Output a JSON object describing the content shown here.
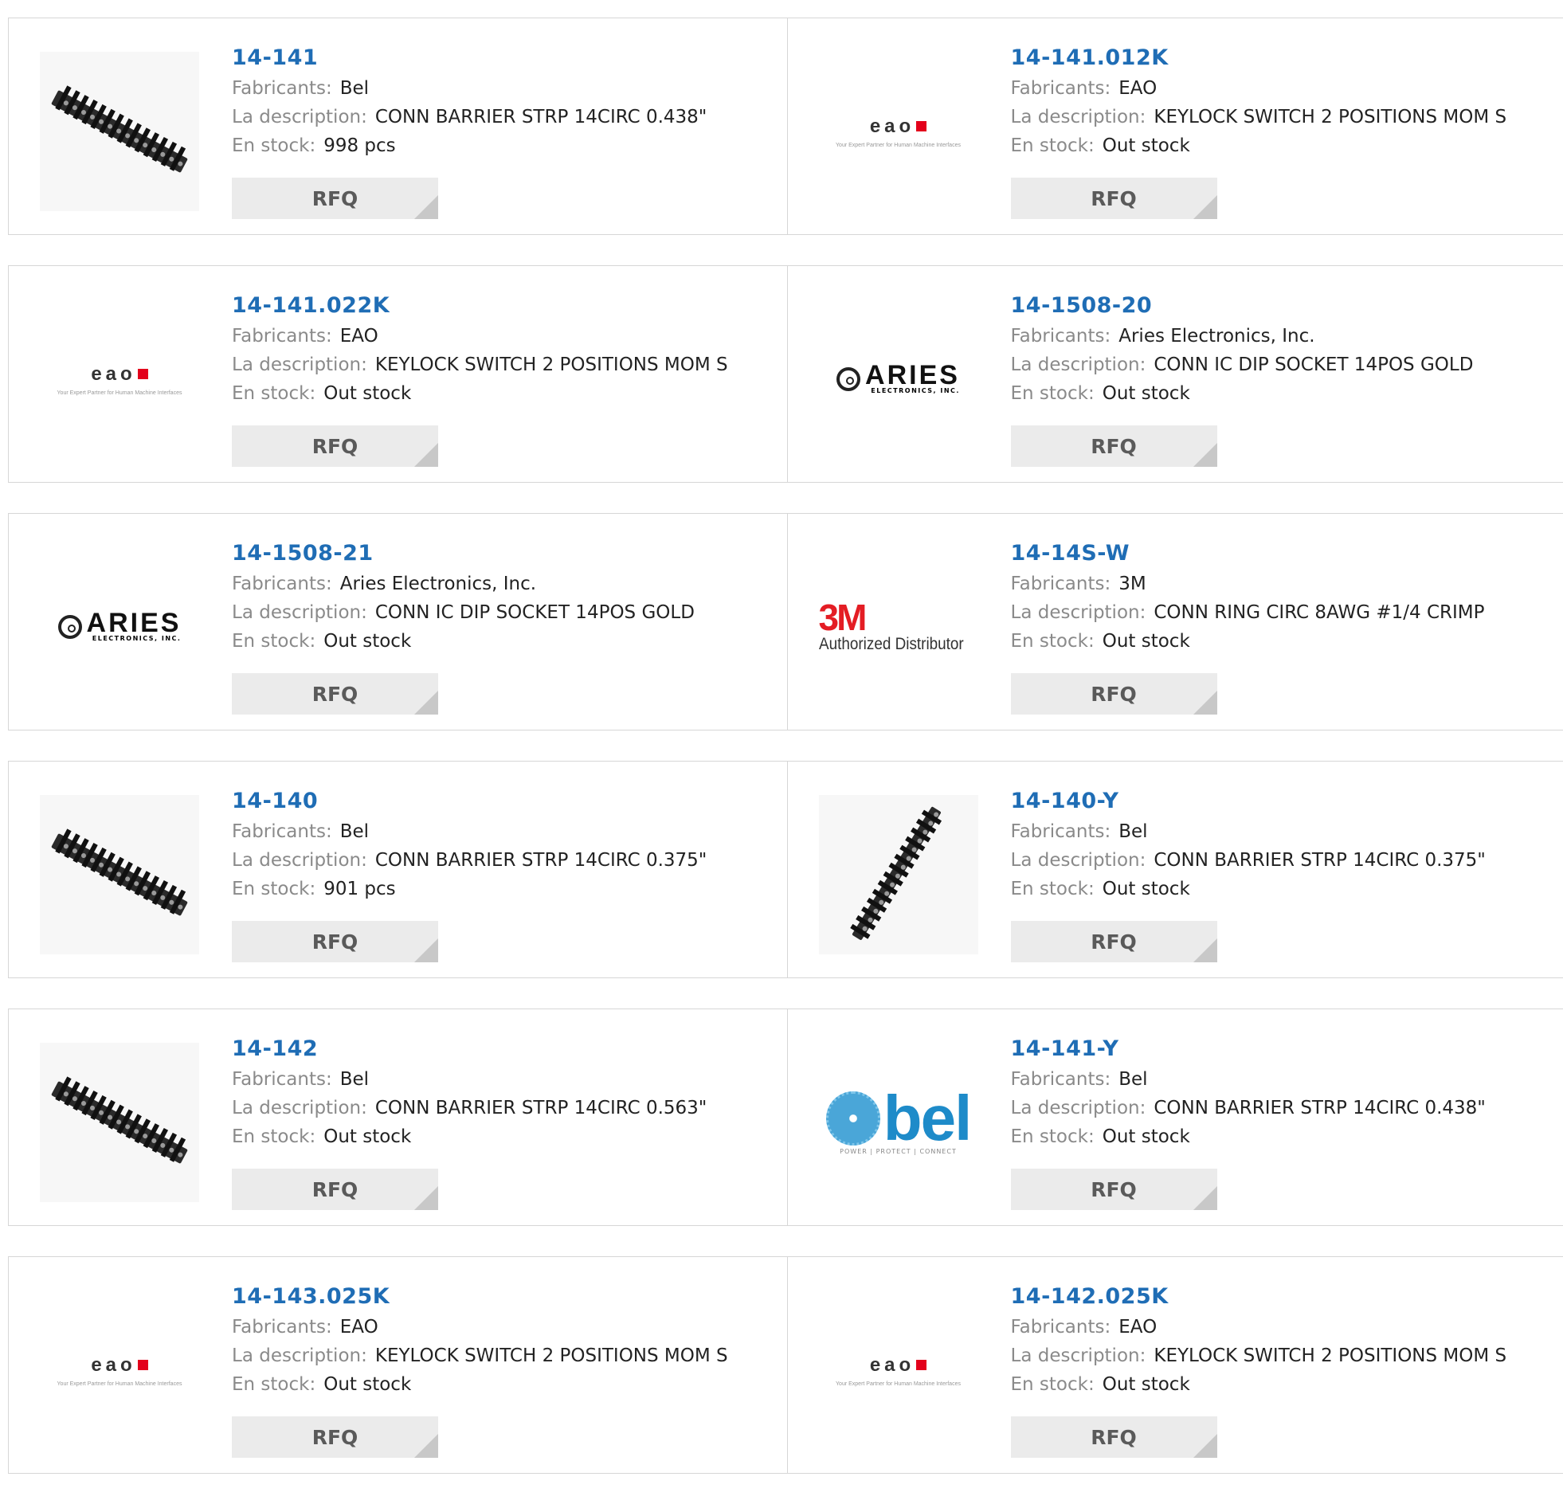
{
  "labels": {
    "manufacturer": "Fabricants:",
    "description": "La description:",
    "stock": "En stock:",
    "rfq": "RFQ"
  },
  "logos": {
    "eao_word": "eao",
    "eao_tagline": "Your Expert Partner for Human Machine Interfaces",
    "aries_word": "ARIES",
    "aries_sub": "ELECTRONICS, INC.",
    "m3_word": "3M",
    "m3_sub": "Authorized Distributor",
    "bel_word": "bel",
    "bel_tag": "POWER | PROTECT | CONNECT"
  },
  "products": [
    {
      "pn": "14-141",
      "mfr": "Bel",
      "desc": "CONN BARRIER STRP 14CIRC 0.438\"",
      "stock": "998 pcs",
      "image": "barrier-strip-icon"
    },
    {
      "pn": "14-141.012K",
      "mfr": "EAO",
      "desc": "KEYLOCK SWITCH 2 POSITIONS MOM S",
      "stock": "Out stock",
      "image": "eao-logo"
    },
    {
      "pn": "14-141.022K",
      "mfr": "EAO",
      "desc": "KEYLOCK SWITCH 2 POSITIONS MOM S",
      "stock": "Out stock",
      "image": "eao-logo"
    },
    {
      "pn": "14-1508-20",
      "mfr": "Aries Electronics, Inc.",
      "desc": "CONN IC DIP SOCKET 14POS GOLD",
      "stock": "Out stock",
      "image": "aries-logo"
    },
    {
      "pn": "14-1508-21",
      "mfr": "Aries Electronics, Inc.",
      "desc": "CONN IC DIP SOCKET 14POS GOLD",
      "stock": "Out stock",
      "image": "aries-logo"
    },
    {
      "pn": "14-14S-W",
      "mfr": "3M",
      "desc": "CONN RING CIRC 8AWG #1/4 CRIMP",
      "stock": "Out stock",
      "image": "3m-logo"
    },
    {
      "pn": "14-140",
      "mfr": "Bel",
      "desc": "CONN BARRIER STRP 14CIRC 0.375\"",
      "stock": "901 pcs",
      "image": "barrier-strip-icon"
    },
    {
      "pn": "14-140-Y",
      "mfr": "Bel",
      "desc": "CONN BARRIER STRP 14CIRC 0.375\"",
      "stock": "Out stock",
      "image": "barrier-strip-steep-icon"
    },
    {
      "pn": "14-142",
      "mfr": "Bel",
      "desc": "CONN BARRIER STRP 14CIRC 0.563\"",
      "stock": "Out stock",
      "image": "barrier-strip-icon"
    },
    {
      "pn": "14-141-Y",
      "mfr": "Bel",
      "desc": "CONN BARRIER STRP 14CIRC 0.438\"",
      "stock": "Out stock",
      "image": "bel-logo"
    },
    {
      "pn": "14-143.025K",
      "mfr": "EAO",
      "desc": "KEYLOCK SWITCH 2 POSITIONS MOM S",
      "stock": "Out stock",
      "image": "eao-logo"
    },
    {
      "pn": "14-142.025K",
      "mfr": "EAO",
      "desc": "KEYLOCK SWITCH 2 POSITIONS MOM S",
      "stock": "Out stock",
      "image": "eao-logo"
    }
  ],
  "colors": {
    "link": "#1f6db5",
    "label": "#8a8a8a",
    "button_bg": "#ebebeb",
    "border": "#d6d6d6",
    "eao_red": "#e3001b",
    "m3_red": "#e41d24",
    "bel_blue": "#1e8bc9"
  }
}
